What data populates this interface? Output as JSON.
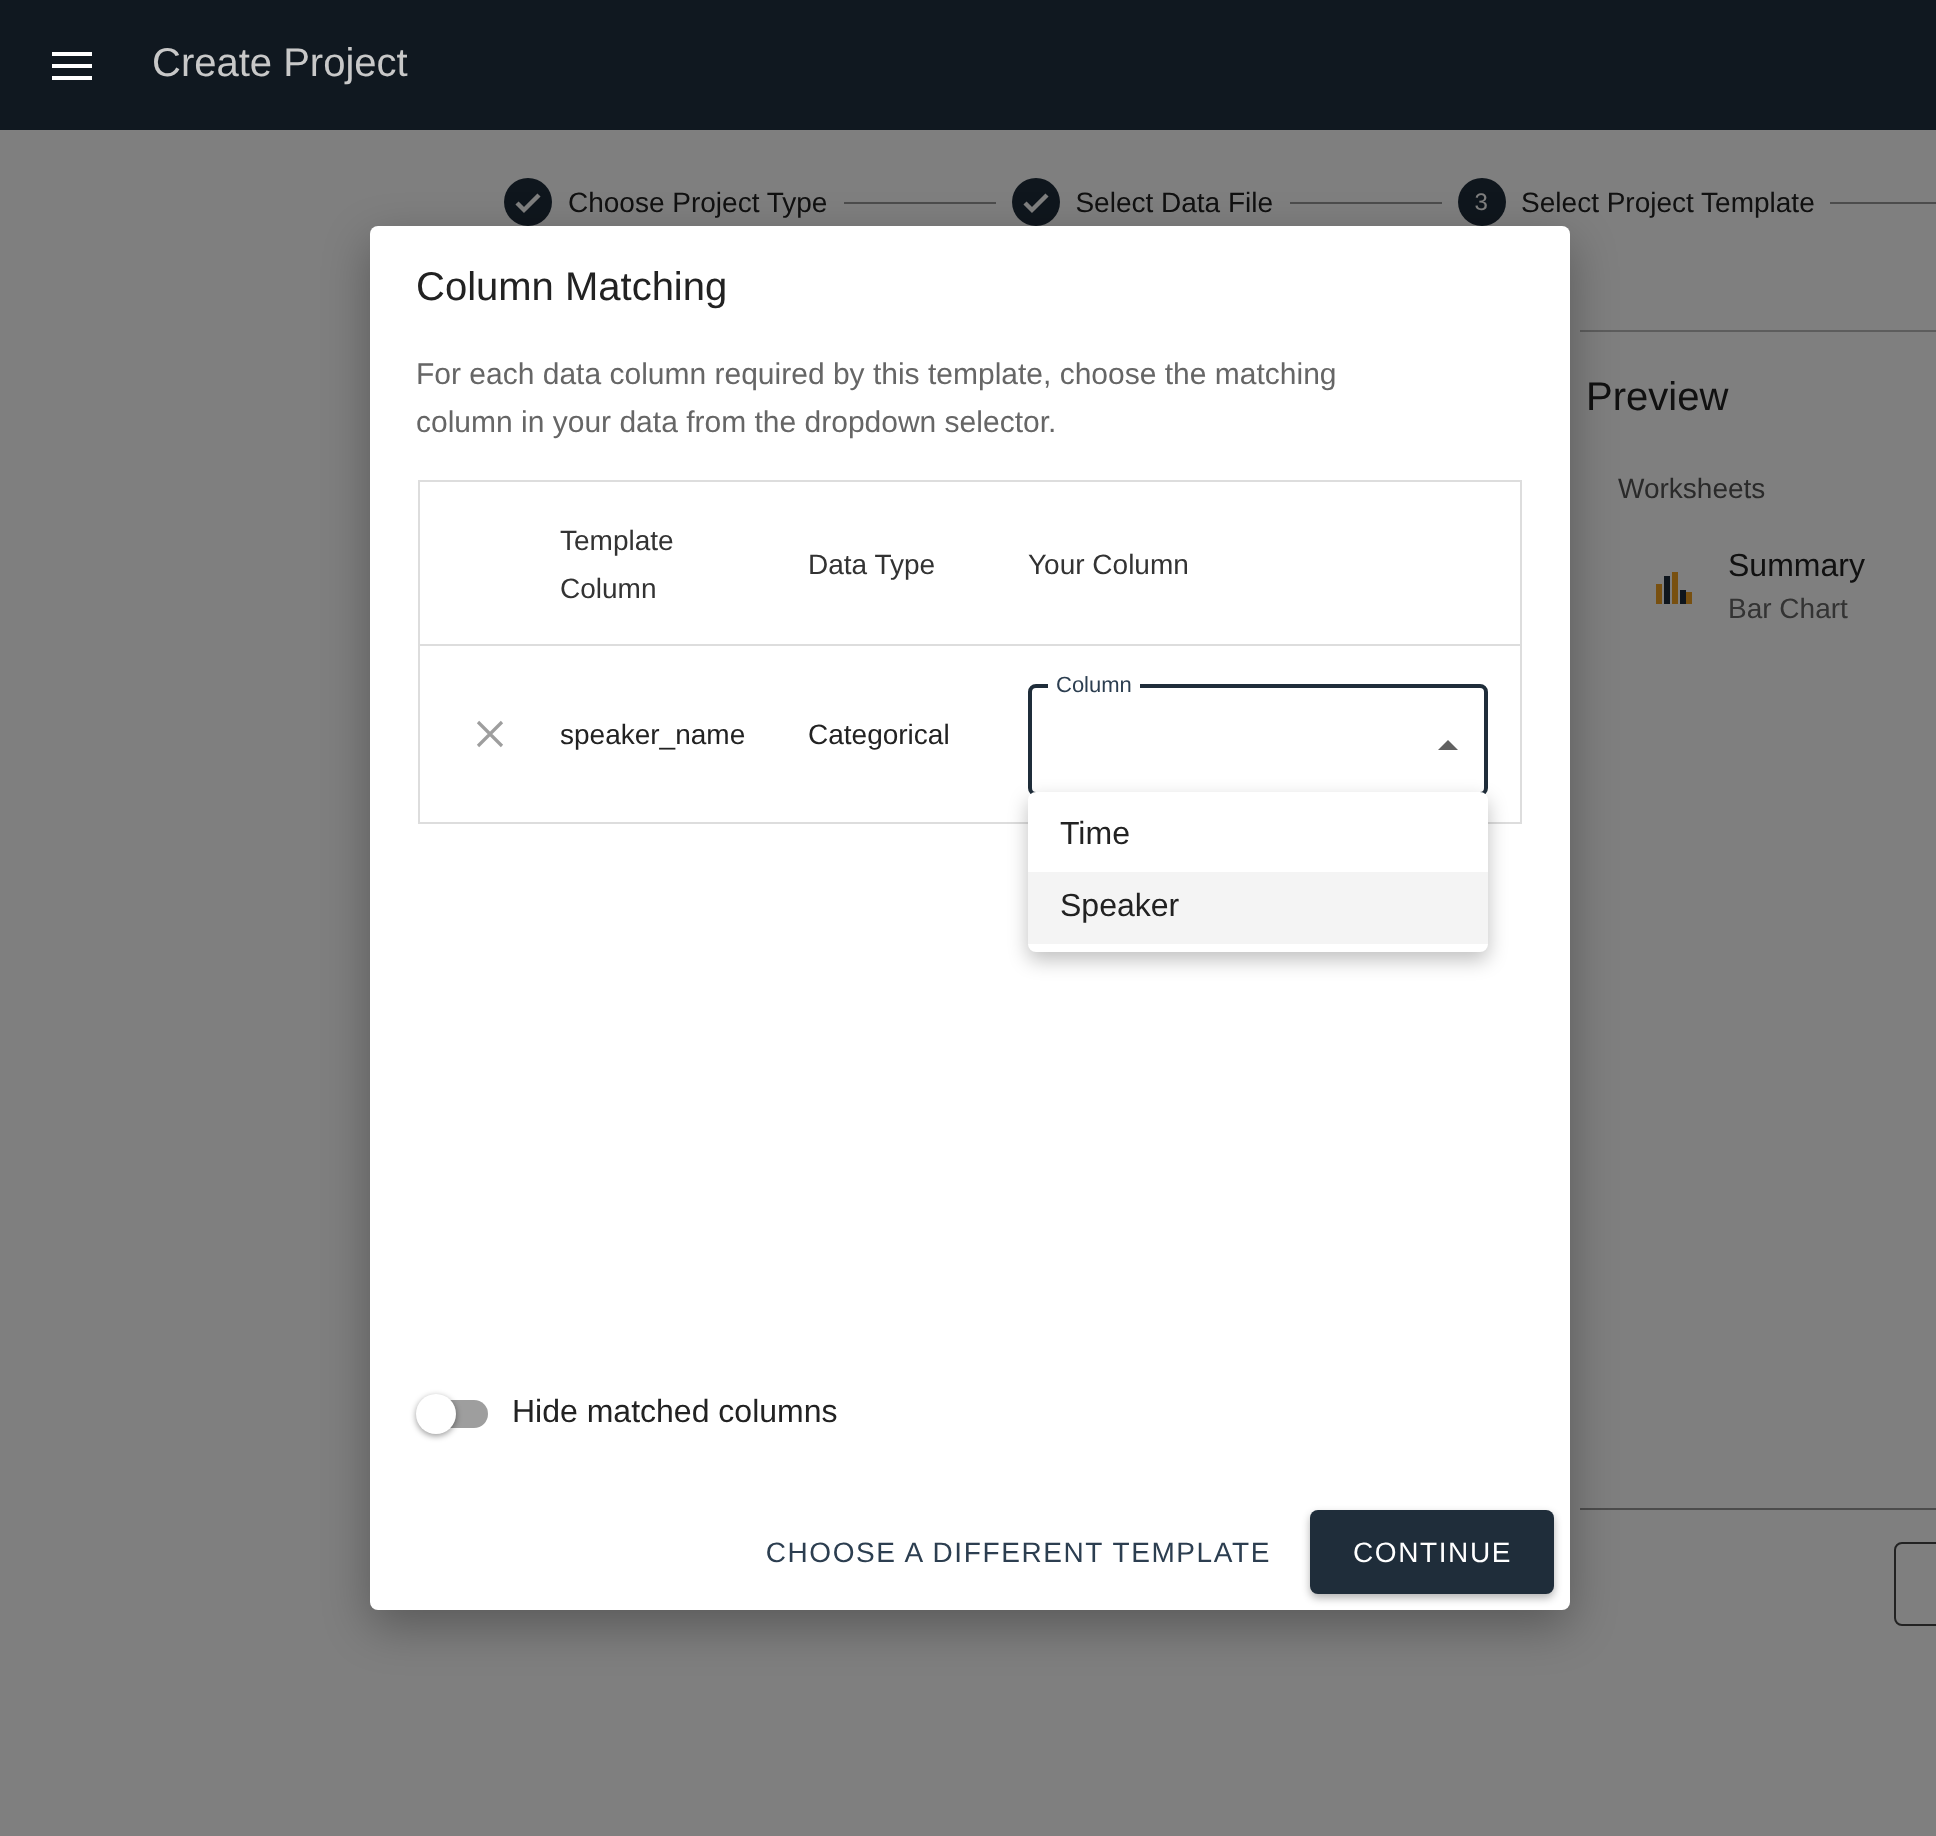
{
  "app_bar": {
    "title": "Create Project"
  },
  "stepper": [
    {
      "label": "Choose Project Type",
      "kind": "done"
    },
    {
      "label": "Select Data File",
      "kind": "done"
    },
    {
      "label": "Select Project Template",
      "kind": "active",
      "number": "3"
    }
  ],
  "preview": {
    "title": "Preview",
    "section": "Worksheets",
    "worksheets": [
      {
        "name": "Summary",
        "type": "Bar Chart"
      }
    ]
  },
  "dialog": {
    "title": "Column Matching",
    "description": "For each data column required by this template, choose the matching column in your data from the dropdown selector.",
    "table": {
      "columns": [
        "Template Column",
        "Data Type",
        "Your Column"
      ],
      "rows": [
        {
          "template_column": "speaker_name",
          "data_type": "Categorical",
          "your_column": {
            "label": "Column",
            "expanded": true
          }
        }
      ]
    },
    "dropdown": [
      {
        "label": "Time",
        "highlighted": false
      },
      {
        "label": "Speaker",
        "highlighted": true
      }
    ],
    "toggle": {
      "label": "Hide matched columns",
      "on": false
    },
    "buttons": [
      {
        "label": "CHOOSE A DIFFERENT TEMPLATE",
        "kind": "text"
      },
      {
        "label": "CONTINUE",
        "kind": "primary"
      }
    ]
  }
}
